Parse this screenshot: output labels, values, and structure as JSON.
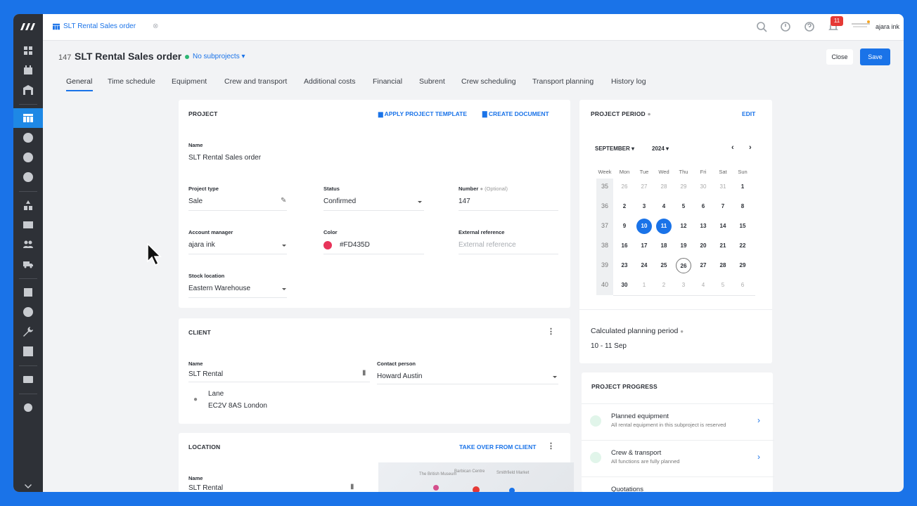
{
  "app": {
    "tab_title": "SLT Rental Sales order",
    "user_name": "ajara ink",
    "notification_count": "11"
  },
  "header": {
    "number": "147",
    "title": "SLT Rental Sales order",
    "subprojects": "No subprojects",
    "close_label": "Close",
    "save_label": "Save"
  },
  "tabs": [
    "General",
    "Time schedule",
    "Equipment",
    "Crew and transport",
    "Additional costs",
    "Financial",
    "Subrent",
    "Crew scheduling",
    "Transport planning",
    "History log"
  ],
  "project": {
    "title": "PROJECT",
    "apply_template": "APPLY PROJECT TEMPLATE",
    "create_document": "CREATE DOCUMENT",
    "name_label": "Name",
    "name_value": "SLT Rental Sales order",
    "type_label": "Project type",
    "type_value": "Sale",
    "status_label": "Status",
    "status_value": "Confirmed",
    "number_label": "Number",
    "number_optional": "(Optional)",
    "number_value": "147",
    "manager_label": "Account manager",
    "manager_value": "ajara ink",
    "color_label": "Color",
    "color_value": "#FD435D",
    "color_hex": "#E8345A",
    "extref_label": "External reference",
    "extref_placeholder": "External reference",
    "stock_label": "Stock location",
    "stock_value": "Eastern Warehouse"
  },
  "client": {
    "title": "CLIENT",
    "name_label": "Name",
    "name_value": "SLT Rental",
    "contact_label": "Contact person",
    "contact_value": "Howard Austin",
    "address_line1": "Lane",
    "address_line2": "EC2V 8AS London"
  },
  "location": {
    "title": "LOCATION",
    "take_over": "TAKE OVER FROM CLIENT",
    "name_label": "Name",
    "name_value": "SLT Rental"
  },
  "period": {
    "title": "PROJECT PERIOD",
    "edit": "EDIT",
    "month": "SEPTEMBER",
    "year": "2024",
    "weekdays": [
      "Week",
      "Mon",
      "Tue",
      "Wed",
      "Thu",
      "Fri",
      "Sat",
      "Sun"
    ],
    "weeks": [
      "35",
      "36",
      "37",
      "38",
      "39",
      "40"
    ],
    "rows": [
      [
        "26",
        "27",
        "28",
        "29",
        "30",
        "31",
        "1"
      ],
      [
        "2",
        "3",
        "4",
        "5",
        "6",
        "7",
        "8"
      ],
      [
        "9",
        "10",
        "11",
        "12",
        "13",
        "14",
        "15"
      ],
      [
        "16",
        "17",
        "18",
        "19",
        "20",
        "21",
        "22"
      ],
      [
        "23",
        "24",
        "25",
        "26",
        "27",
        "28",
        "29"
      ],
      [
        "30",
        "1",
        "2",
        "3",
        "4",
        "5",
        "6"
      ]
    ],
    "calc_label": "Calculated planning period",
    "calc_value": "10 - 11 Sep"
  },
  "progress": {
    "title": "PROJECT PROGRESS",
    "items": [
      {
        "title": "Planned equipment",
        "sub": "All rental equipment in this subproject is reserved"
      },
      {
        "title": "Crew & transport",
        "sub": "All functions are fully planned"
      },
      {
        "title": "Quotations",
        "sub": ""
      }
    ]
  },
  "map_labels": [
    "Barbican Centre",
    "The British Museum",
    "Smithfield Market"
  ]
}
